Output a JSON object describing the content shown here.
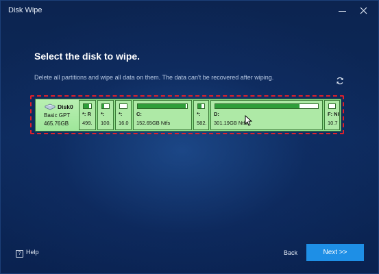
{
  "window": {
    "title": "Disk Wipe"
  },
  "main": {
    "heading": "Select the disk to wipe.",
    "description": "Delete all partitions and wipe all data on them. The data can't be recovered after wiping."
  },
  "disk": {
    "name": "Disk0",
    "type": "Basic GPT",
    "size": "465.76GB",
    "partitions": [
      {
        "label": "*: R",
        "size": "499.",
        "used_fraction": 0.75
      },
      {
        "label": "*:",
        "size": "100.",
        "used_fraction": 0.25
      },
      {
        "label": "*:",
        "size": "16.0",
        "used_fraction": 0.0
      },
      {
        "label": "C:",
        "size": "152.65GB Ntfs",
        "used_fraction": 0.97
      },
      {
        "label": "*:",
        "size": "582.",
        "used_fraction": 0.6
      },
      {
        "label": "D:",
        "size": "301.19GB Ntfs",
        "used_fraction": 0.82
      },
      {
        "label": "F: NI",
        "size": "10.7",
        "used_fraction": 0.0
      }
    ]
  },
  "footer": {
    "help_label": "Help",
    "back_label": "Back",
    "next_label": "Next >>"
  },
  "colors": {
    "accent": "#1e8fe6",
    "selection_border": "#e0202a",
    "partition_fill": "#2f9e3a"
  }
}
